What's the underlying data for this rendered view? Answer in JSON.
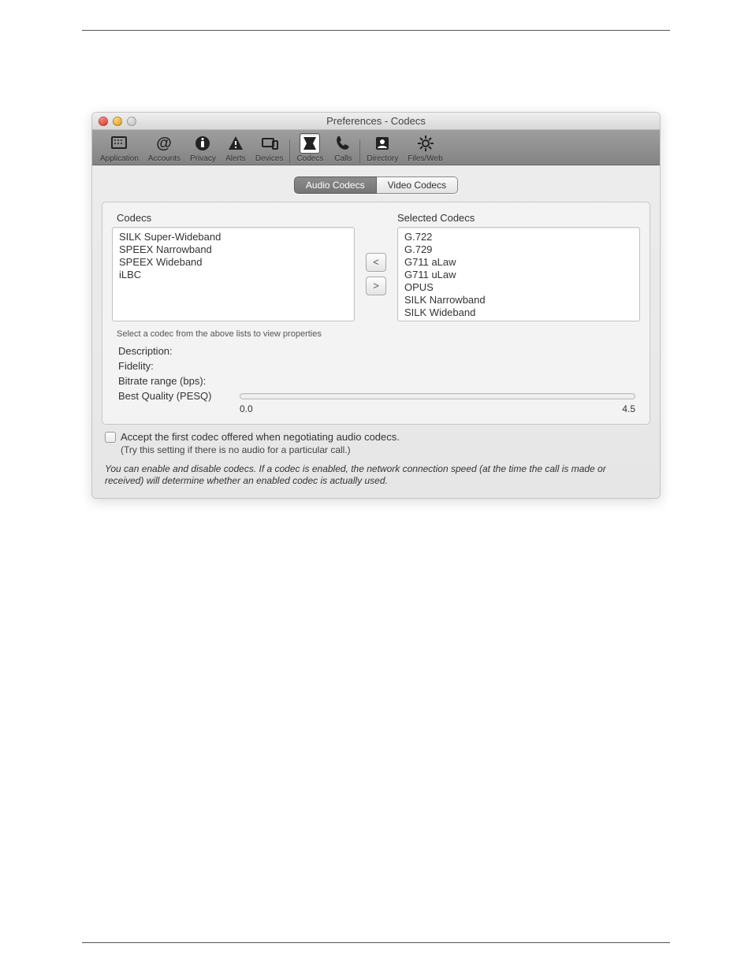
{
  "window": {
    "title": "Preferences - Codecs"
  },
  "toolbar": {
    "items": [
      {
        "label": "Application"
      },
      {
        "label": "Accounts"
      },
      {
        "label": "Privacy"
      },
      {
        "label": "Alerts"
      },
      {
        "label": "Devices"
      },
      {
        "label": "Codecs"
      },
      {
        "label": "Calls"
      },
      {
        "label": "Directory"
      },
      {
        "label": "Files/Web"
      }
    ]
  },
  "tabs": {
    "audio": "Audio Codecs",
    "video": "Video Codecs"
  },
  "lists": {
    "available_title": "Codecs",
    "available": [
      "SILK Super-Wideband",
      "SPEEX Narrowband",
      "SPEEX Wideband",
      "iLBC"
    ],
    "selected_title": "Selected Codecs",
    "selected": [
      "G.722",
      "G.729",
      "G711 aLaw",
      "G711 uLaw",
      "OPUS",
      "SILK Narrowband",
      "SILK Wideband"
    ],
    "move_left": "<",
    "move_right": ">"
  },
  "props": {
    "hint": "Select a codec from the above lists to view properties",
    "description": "Description:",
    "fidelity": "Fidelity:",
    "bitrate": "Bitrate range (bps):",
    "quality": "Best Quality (PESQ)",
    "scale_min": "0.0",
    "scale_max": "4.5"
  },
  "accept": {
    "label": "Accept the first codec offered when negotiating audio codecs.",
    "hint": "(Try this setting if there is no audio for a particular call.)"
  },
  "note": "You can enable and disable codecs. If a codec is enabled, the network connection speed (at the time the call is made or received) will determine whether an enabled codec is actually used."
}
